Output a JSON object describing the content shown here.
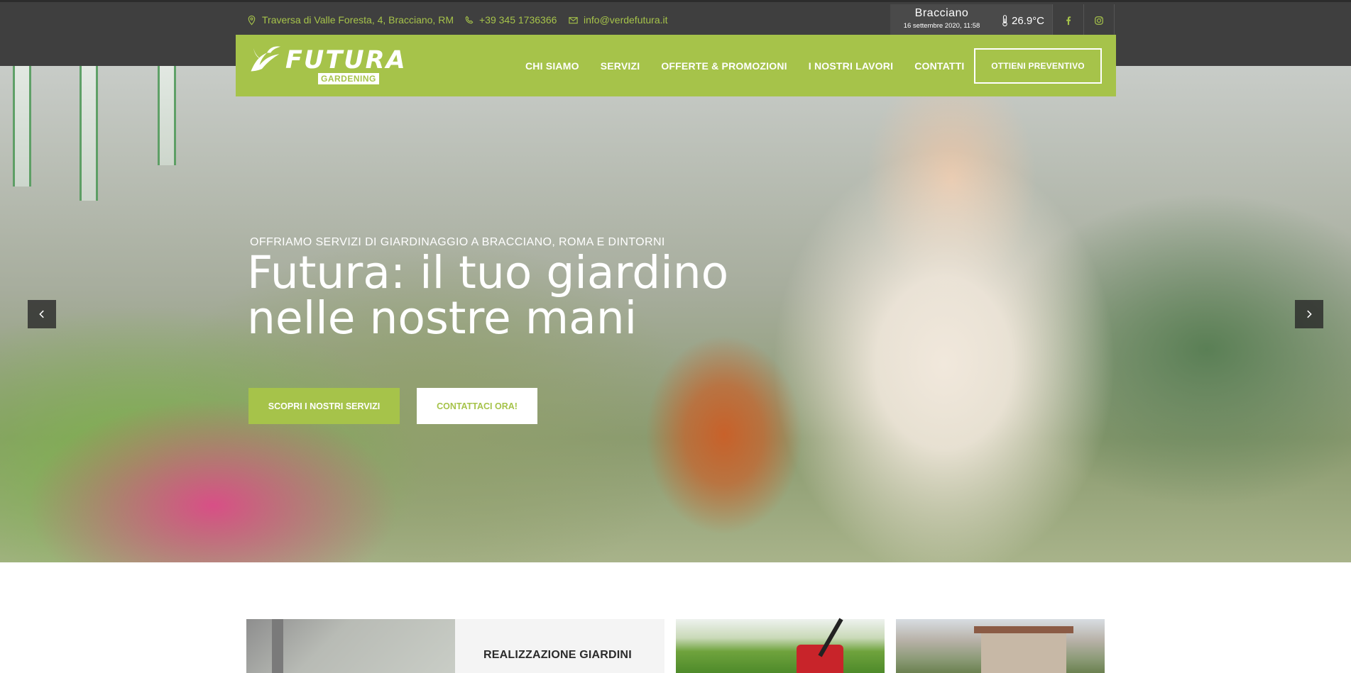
{
  "topbar": {
    "address": "Traversa di Valle Foresta, 4, Bracciano, RM",
    "phone": "+39 345 1736366",
    "email": "info@verdefutura.it",
    "weather": {
      "city": "Bracciano",
      "datetime": "16 settembre 2020, 11:58",
      "temperature": "26.9°C"
    },
    "social": [
      "facebook-icon",
      "instagram-icon"
    ]
  },
  "logo": {
    "word": "FUTURA",
    "sub": "GARDENING"
  },
  "nav": {
    "items": [
      {
        "label": "CHI SIAMO"
      },
      {
        "label": "SERVIZI"
      },
      {
        "label": "OFFERTE & PROMOZIONI"
      },
      {
        "label": "I NOSTRI LAVORI"
      },
      {
        "label": "CONTATTI"
      }
    ],
    "cta": "OTTIENI PREVENTIVO"
  },
  "hero": {
    "subtitle": "OFFRIAMO SERVIZI DI GIARDINAGGIO A BRACCIANO, ROMA E DINTORNI",
    "title_line1": "Futura: il tuo giardino",
    "title_line2": "nelle nostre mani",
    "primary_button": "SCOPRI I NOSTRI SERVIZI",
    "secondary_button": "CONTATTACI ORA!"
  },
  "cards": {
    "title": "REALIZZAZIONE GIARDINI"
  },
  "colors": {
    "accent": "#a6c34a",
    "topbar": "#3f3f3f",
    "weather_bg": "#4a4a4a"
  }
}
